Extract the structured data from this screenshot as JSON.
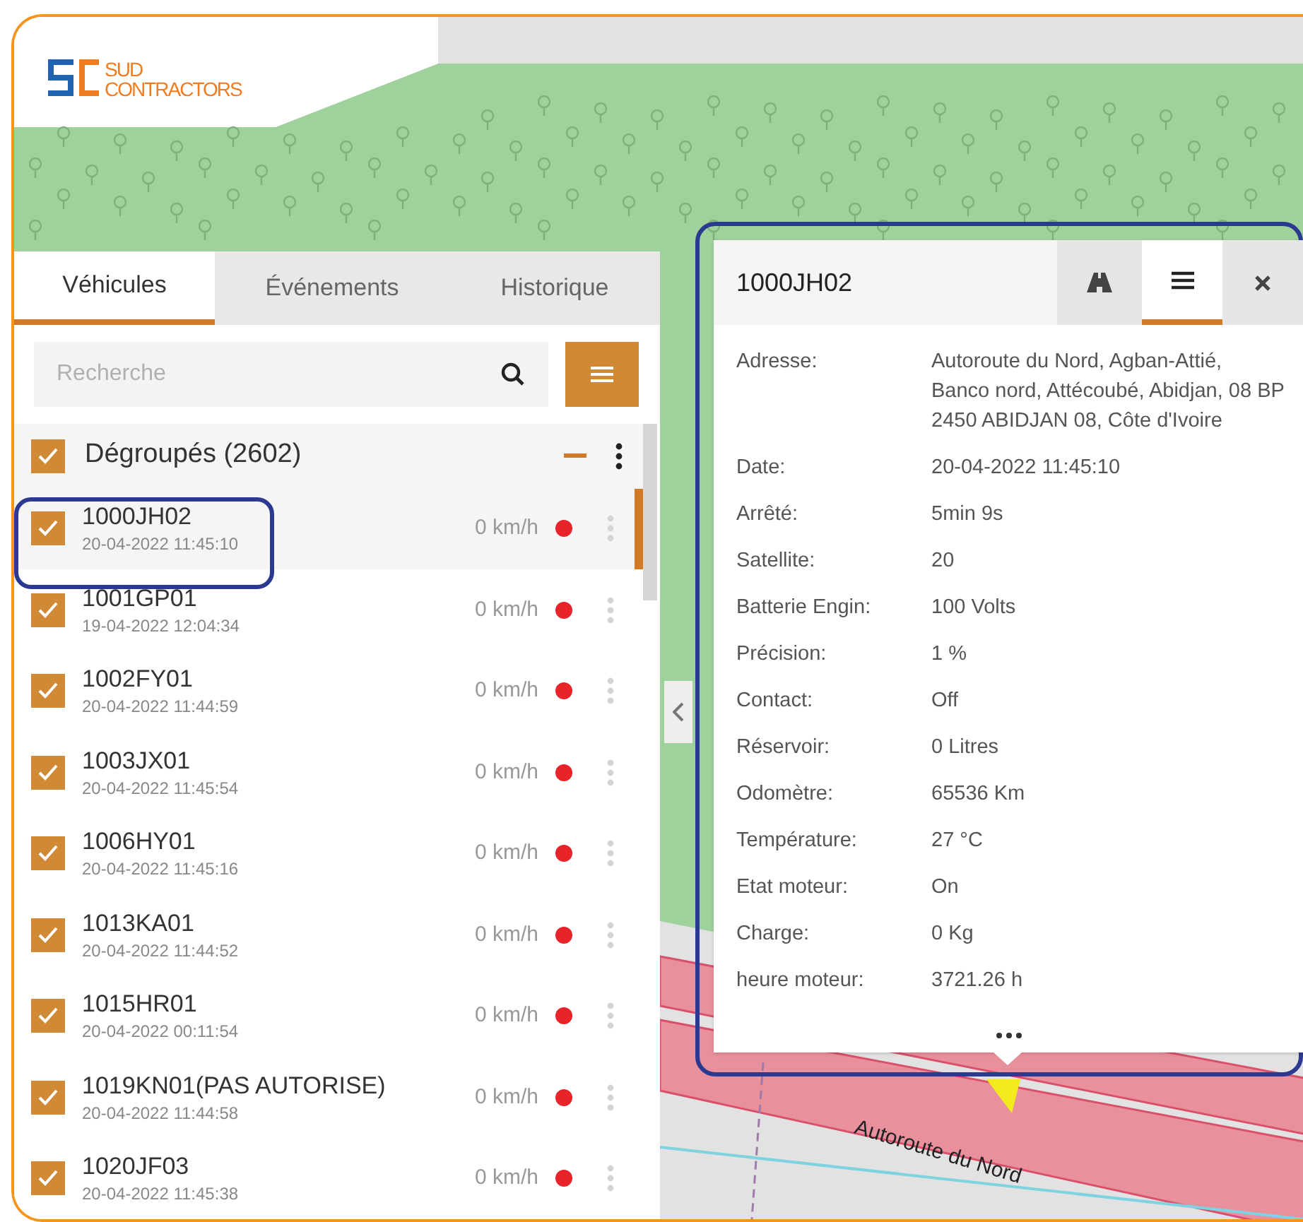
{
  "logo": {
    "line_1": "SUD",
    "line_2": "CONTRACTORS"
  },
  "tabs": [
    {
      "label": "Véhicules",
      "selected": true
    },
    {
      "label": "Événements",
      "selected": false
    },
    {
      "label": "Historique",
      "selected": false
    }
  ],
  "search": {
    "placeholder": "Recherche"
  },
  "group": {
    "label": "Dégroupés (2602)",
    "checked": true
  },
  "vehicles": [
    {
      "name": "1000JH02",
      "time": "20-04-2022 11:45:10",
      "speed": "0 km/h",
      "color": "#e8232a",
      "checked": true,
      "selected": true
    },
    {
      "name": "1001GP01",
      "time": "19-04-2022 12:04:34",
      "speed": "0 km/h",
      "color": "#e8232a",
      "checked": true,
      "selected": false
    },
    {
      "name": "1002FY01",
      "time": "20-04-2022 11:44:59",
      "speed": "0 km/h",
      "color": "#e8232a",
      "checked": true,
      "selected": false
    },
    {
      "name": "1003JX01",
      "time": "20-04-2022 11:45:54",
      "speed": "0 km/h",
      "color": "#e8232a",
      "checked": true,
      "selected": false
    },
    {
      "name": "1006HY01",
      "time": "20-04-2022 11:45:16",
      "speed": "0 km/h",
      "color": "#e8232a",
      "checked": true,
      "selected": false
    },
    {
      "name": "1013KA01",
      "time": "20-04-2022 11:44:52",
      "speed": "0 km/h",
      "color": "#e8232a",
      "checked": true,
      "selected": false
    },
    {
      "name": "1015HR01",
      "time": "20-04-2022 00:11:54",
      "speed": "0 km/h",
      "color": "#e8232a",
      "checked": true,
      "selected": false
    },
    {
      "name": "1019KN01(PAS AUTORISE)",
      "time": "20-04-2022 11:44:58",
      "speed": "0 km/h",
      "color": "#e8232a",
      "checked": true,
      "selected": false
    },
    {
      "name": "1020JF03",
      "time": "20-04-2022 11:45:38",
      "speed": "0 km/h",
      "color": "#e8232a",
      "checked": true,
      "selected": false
    }
  ],
  "popup": {
    "title": "1000JH02",
    "tabs": [
      {
        "kind": "road",
        "selected": false
      },
      {
        "kind": "list",
        "selected": true
      }
    ],
    "fields": [
      {
        "label": "Adresse:",
        "value": "Autoroute du Nord, Agban-Attié, Banco nord, Attécoubé, Abidjan, 08 BP 2450 ABIDJAN 08, Côte d'Ivoire"
      },
      {
        "label": "Date:",
        "value": "20-04-2022 11:45:10"
      },
      {
        "label": "Arrêté:",
        "value": "5min 9s"
      },
      {
        "label": "Satellite:",
        "value": "20"
      },
      {
        "label": "Batterie Engin:",
        "value": "100 Volts"
      },
      {
        "label": "Précision:",
        "value": "1 %"
      },
      {
        "label": "Contact:",
        "value": "Off"
      },
      {
        "label": "Réservoir:",
        "value": "0 Litres"
      },
      {
        "label": "Odomètre:",
        "value": "65536 Km"
      },
      {
        "label": "Température:",
        "value": "27 °C"
      },
      {
        "label": "Etat moteur:",
        "value": "On"
      },
      {
        "label": "Charge:",
        "value": "0 Kg"
      },
      {
        "label": "heure moteur:",
        "value": "3721.26 h"
      }
    ]
  },
  "map_labels": [
    "Autoroute du Nord"
  ]
}
